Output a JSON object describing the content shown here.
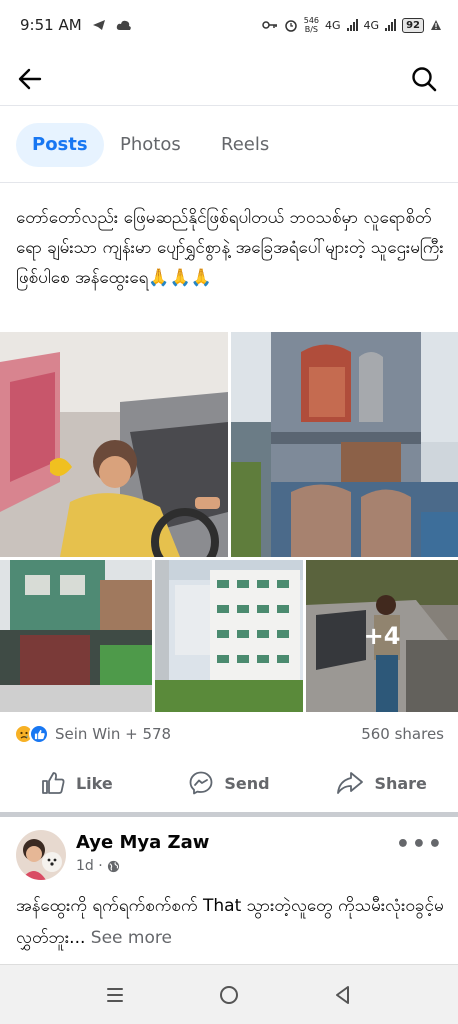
{
  "status_bar": {
    "time": "9:51 AM",
    "net_speed_value": "546",
    "net_speed_unit": "B/S",
    "network_1": "4G",
    "network_2": "4G",
    "battery": "92"
  },
  "tabs": [
    {
      "label": "Posts",
      "active": true
    },
    {
      "label": "Photos",
      "active": false
    },
    {
      "label": "Reels",
      "active": false
    }
  ],
  "post": {
    "text": "တော်တော်လည်း ဖြေမဆည်နိုင်ဖြစ်ရပါတယ် ဘဝသစ်မှာ လူရောစိတ်ရော ချမ်းသာ ကျန်းမာ ပျော်ရွှင်စွာနဲ့ အခြေအရံပေါ်များတဲ့ သူဌေးမကြီး ဖြစ်ပါစေ အန်ထွေးရေ🙏🙏🙏",
    "more_photos": "+4",
    "reactions_text": "Sein Win + 578",
    "shares_text": "560 shares",
    "actions": {
      "like": "Like",
      "send": "Send",
      "share": "Share"
    }
  },
  "post2": {
    "author": "Aye Mya Zaw",
    "time": "1d ·",
    "text": "အန်ထွေးကို ရက်ရက်စက်စက် That သွားတဲ့လူတွေ ကိုသမီးလုံးဝခွင့်မလွှတ်ဘူး...",
    "see_more": "See more",
    "more": "•••"
  },
  "icons": {
    "back": "arrow-left-icon",
    "search": "search-icon",
    "like": "thumbs-up-icon",
    "send": "messenger-icon",
    "share": "share-arrow-icon",
    "globe": "globe-icon"
  },
  "colors": {
    "accent": "#1877f2",
    "active_tab_bg": "#e7f3ff",
    "secondary_text": "#65676b"
  }
}
